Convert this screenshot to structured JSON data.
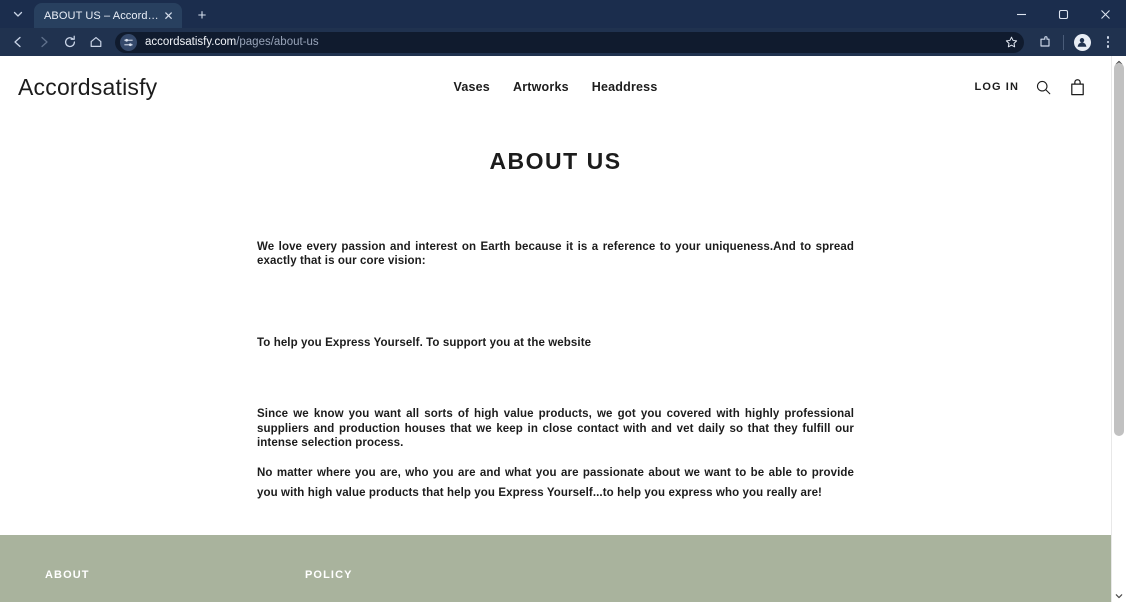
{
  "browser": {
    "tab": {
      "title": "ABOUT US – Accordsatisfy",
      "close_label": "✕"
    },
    "new_tab_label": "+",
    "tab_list_icon": "chevron-down-icon",
    "window_controls": {
      "minimize": "–",
      "maximize": "□",
      "close": "✕"
    },
    "nav": {
      "back": "←",
      "forward": "→",
      "reload": "↻",
      "home": "⌂"
    },
    "omnibox": {
      "site_settings_icon": "tune-icon",
      "url_host": "accordsatisfy.com",
      "url_path": "/pages/about-us",
      "bookmark_icon": "star-icon"
    },
    "toolbar_icons": {
      "extensions": "extensions-icon",
      "profile": "profile-avatar-icon",
      "menu": "three-dot-menu-icon"
    }
  },
  "site": {
    "logo": "Accordsatisfy",
    "nav": [
      {
        "label": "Vases"
      },
      {
        "label": "Artworks"
      },
      {
        "label": "Headdress"
      }
    ],
    "login_label": "LOG IN",
    "search_icon": "search-icon",
    "cart_icon": "shopping-bag-icon"
  },
  "main": {
    "title": "ABOUT US",
    "paragraphs": [
      "We love every passion and interest on Earth because it is a reference to your uniqueness.And to spread exactly that is our core vision:",
      "To help you Express Yourself. To support you at the website",
      "Since we know you want all sorts of high value products, we got you covered with highly professional suppliers and production houses that we keep in close contact with and vet daily so that they fulfill our intense selection process.",
      "No matter where you are, who you are and what you are passionate about we want to be able to provide you with high value products that help you Express Yourself...to help you express who you really are!"
    ]
  },
  "footer": {
    "columns": [
      {
        "title": "ABOUT"
      },
      {
        "title": "POLICY"
      }
    ],
    "background_color": "#a9b39d"
  }
}
